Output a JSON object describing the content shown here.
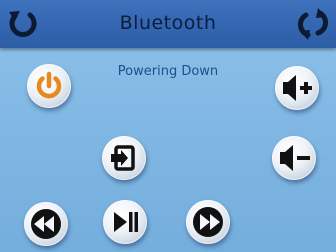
{
  "header": {
    "title": "Bluetooth",
    "left_icon": "power-cycle-icon",
    "right_icon": "refresh-icon"
  },
  "status": {
    "text": "Powering Down"
  },
  "buttons": {
    "power": "power-icon",
    "volume_up": "volume-up-icon",
    "input": "input-select-icon",
    "volume_down": "volume-down-icon",
    "rewind": "rewind-icon",
    "play_pause": "play-pause-icon",
    "fast_forward": "fast-forward-icon"
  },
  "colors": {
    "header_bg": "#3466b2",
    "screen_bg": "#82b9e3",
    "accent_orange": "#e8891f",
    "icon_dark": "#111111"
  }
}
